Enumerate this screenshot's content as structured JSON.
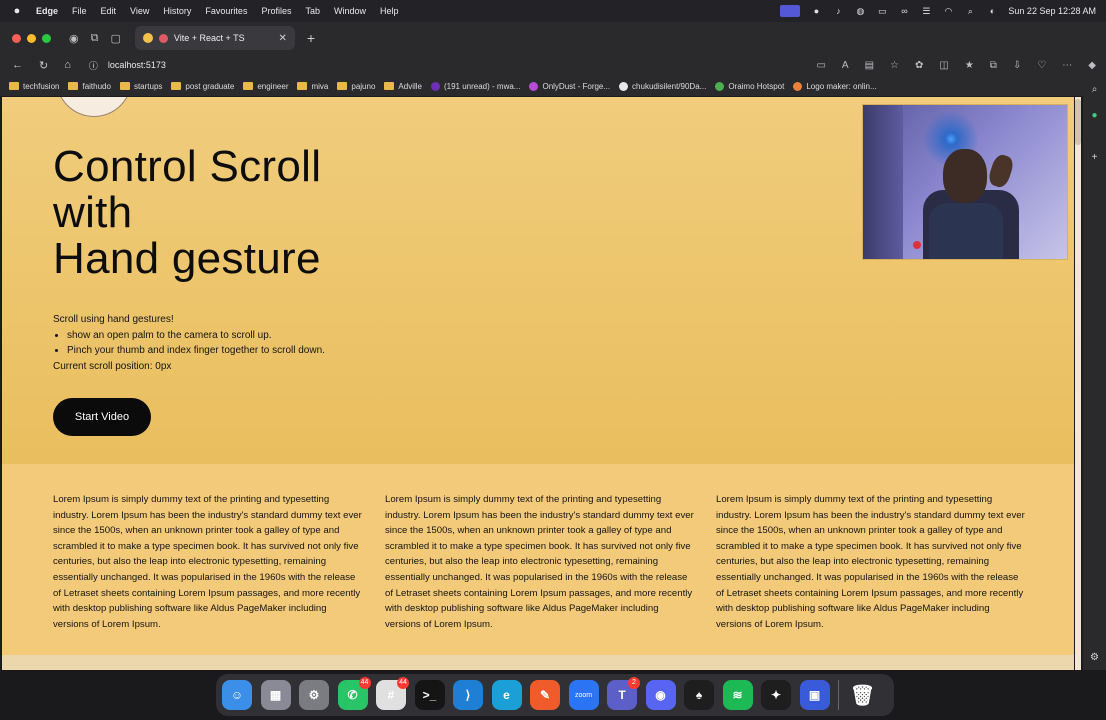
{
  "menubar": {
    "app_name": "Edge",
    "items": [
      "File",
      "Edit",
      "View",
      "History",
      "Favourites",
      "Profiles",
      "Tab",
      "Window",
      "Help"
    ],
    "clock": "Sun 22 Sep  12:28 AM"
  },
  "browser": {
    "tab_title": "Vite + React + TS",
    "url": "localhost:5173",
    "bookmarks": [
      {
        "label": "techfusion",
        "kind": "folder"
      },
      {
        "label": "faithudo",
        "kind": "folder"
      },
      {
        "label": "startups",
        "kind": "folder"
      },
      {
        "label": "post graduate",
        "kind": "folder"
      },
      {
        "label": "engineer",
        "kind": "folder"
      },
      {
        "label": "miva",
        "kind": "folder"
      },
      {
        "label": "pajuno",
        "kind": "folder"
      },
      {
        "label": "Adville",
        "kind": "folder"
      },
      {
        "label": "(191 unread) - mwa...",
        "kind": "site",
        "color": "#6d2fb8"
      },
      {
        "label": "OnlyDust - Forge...",
        "kind": "site",
        "color": "#b64bd6"
      },
      {
        "label": "chukudisilent/90Da...",
        "kind": "site",
        "color": "#e8e8e8"
      },
      {
        "label": "Oraimo Hotspot",
        "kind": "site",
        "color": "#4caf50"
      },
      {
        "label": "Logo maker: onlin...",
        "kind": "site",
        "color": "#e9813a"
      }
    ]
  },
  "page": {
    "hero": {
      "title_line1": "Control Scroll",
      "title_line2": "with",
      "title_line3": "Hand gesture",
      "instructions_title": "Scroll using hand gestures!",
      "bullets": [
        "show an open palm to the camera to scroll up.",
        "Pinch your thumb and index finger together to scroll down."
      ],
      "scroll_position": "Current scroll position: 0px",
      "button_label": "Start Video"
    },
    "lorem": [
      "Lorem Ipsum is simply dummy text of the printing and typesetting industry. Lorem Ipsum has been the industry's standard dummy text ever since the 1500s, when an unknown printer took a galley of type and scrambled it to make a type specimen book. It has survived not only five centuries, but also the leap into electronic typesetting, remaining essentially unchanged. It was popularised in the 1960s with the release of Letraset sheets containing Lorem Ipsum passages, and more recently with desktop publishing software like Aldus PageMaker including versions of Lorem Ipsum.",
      "Lorem Ipsum is simply dummy text of the printing and typesetting industry. Lorem Ipsum has been the industry's standard dummy text ever since the 1500s, when an unknown printer took a galley of type and scrambled it to make a type specimen book. It has survived not only five centuries, but also the leap into electronic typesetting, remaining essentially unchanged. It was popularised in the 1960s with the release of Letraset sheets containing Lorem Ipsum passages, and more recently with desktop publishing software like Aldus PageMaker including versions of Lorem Ipsum.",
      "Lorem Ipsum is simply dummy text of the printing and typesetting industry. Lorem Ipsum has been the industry's standard dummy text ever since the 1500s, when an unknown printer took a galley of type and scrambled it to make a type specimen book. It has survived not only five centuries, but also the leap into electronic typesetting, remaining essentially unchanged. It was popularised in the 1960s with the release of Letraset sheets containing Lorem Ipsum passages, and more recently with desktop publishing software like Aldus PageMaker including versions of Lorem Ipsum."
    ]
  },
  "dock": {
    "apps": [
      {
        "name": "finder-icon",
        "color": "#3b8fe8",
        "glyph": "☺",
        "badge": ""
      },
      {
        "name": "launchpad-icon",
        "color": "#8a8a96",
        "glyph": "▦",
        "badge": ""
      },
      {
        "name": "system-settings-icon",
        "color": "#7b7b82",
        "glyph": "⚙",
        "badge": ""
      },
      {
        "name": "whatsapp-icon",
        "color": "#29c466",
        "glyph": "✆",
        "badge": "44"
      },
      {
        "name": "slack-icon",
        "color": "#e0e0e0",
        "glyph": "#",
        "badge": "44"
      },
      {
        "name": "terminal-icon",
        "color": "#151515",
        "glyph": ">_",
        "badge": ""
      },
      {
        "name": "vscode-icon",
        "color": "#1f7fd4",
        "glyph": "⟩",
        "badge": ""
      },
      {
        "name": "edge-icon",
        "color": "#1a9fd6",
        "glyph": "e",
        "badge": ""
      },
      {
        "name": "postman-icon",
        "color": "#ef5b2a",
        "glyph": "✎",
        "badge": ""
      },
      {
        "name": "zoom-icon",
        "color": "#2b74f3",
        "glyph": "zoom",
        "badge": ""
      },
      {
        "name": "teams-icon",
        "color": "#5b5fc7",
        "glyph": "T",
        "badge": "2"
      },
      {
        "name": "discord-icon",
        "color": "#5865f2",
        "glyph": "◉",
        "badge": ""
      },
      {
        "name": "mongodb-icon",
        "color": "#1e1e1e",
        "glyph": "♠",
        "badge": ""
      },
      {
        "name": "spotify-icon",
        "color": "#1db954",
        "glyph": "≋",
        "badge": ""
      },
      {
        "name": "figma-icon",
        "color": "#1e1e1e",
        "glyph": "✦",
        "badge": ""
      },
      {
        "name": "simulator-icon",
        "color": "#3a5bd9",
        "glyph": "▣",
        "badge": ""
      }
    ],
    "trash": {
      "name": "trash-icon",
      "color": "#9a9aa0",
      "glyph": "🗑"
    }
  }
}
